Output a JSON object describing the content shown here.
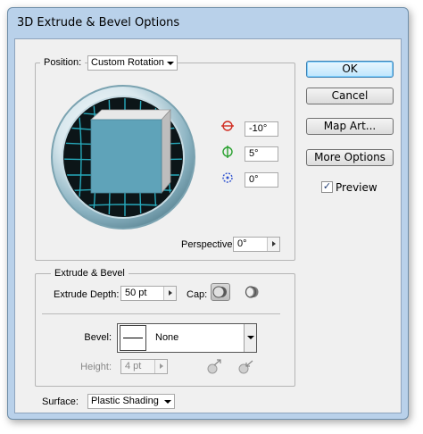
{
  "window": {
    "title": "3D Extrude & Bevel Options"
  },
  "position": {
    "label": "Position:",
    "preset": "Custom Rotation",
    "rotation_x": "-10°",
    "rotation_y": "5°",
    "rotation_z": "0°",
    "perspective_label": "Perspective:",
    "perspective": "0°"
  },
  "buttons": {
    "ok": "OK",
    "cancel": "Cancel",
    "map_art": "Map Art...",
    "more_options": "More Options"
  },
  "preview": {
    "label": "Preview",
    "checked": "✓"
  },
  "extrude": {
    "legend": "Extrude & Bevel",
    "depth_label": "Extrude Depth:",
    "depth": "50 pt",
    "cap_label": "Cap:",
    "bevel_label": "Bevel:",
    "bevel": "None",
    "height_label": "Height:",
    "height": "4 pt"
  },
  "surface": {
    "label": "Surface:",
    "value": "Plastic Shading"
  }
}
